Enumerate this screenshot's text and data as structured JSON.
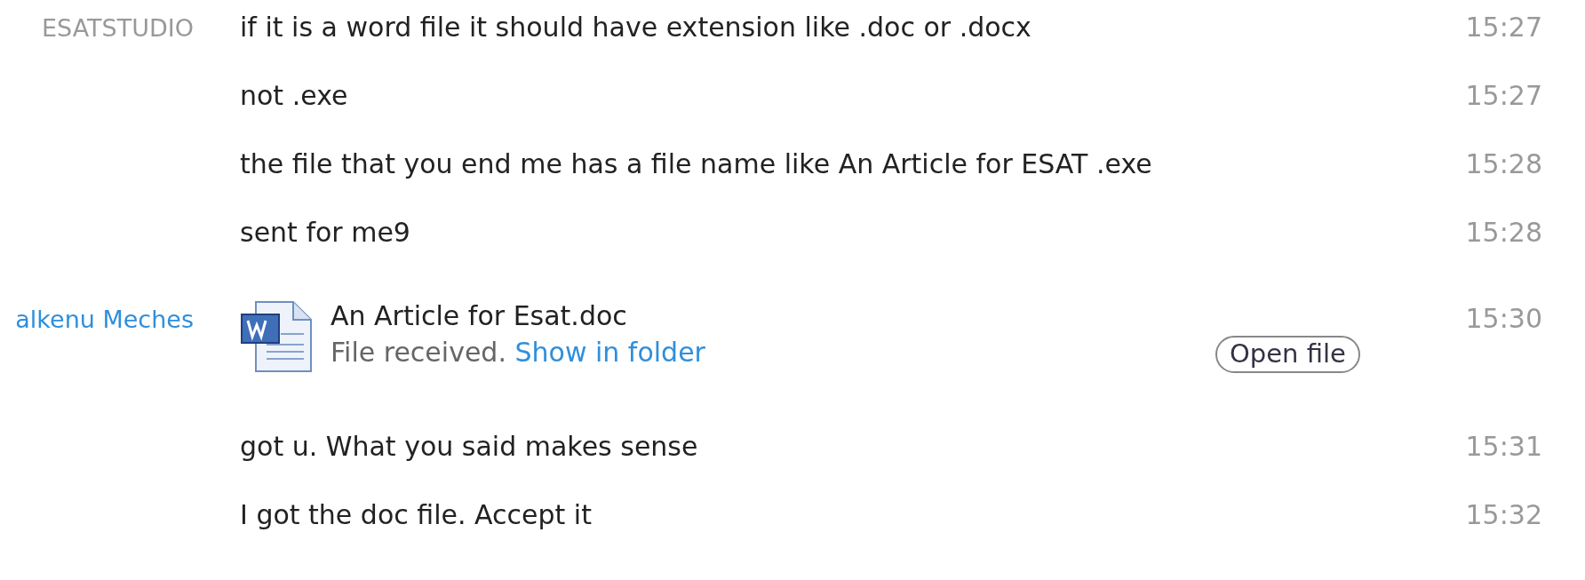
{
  "messages": [
    {
      "kind": "text",
      "sender": "ESATSTUDIO",
      "color": "#999999",
      "text": "if it is a word file it should have extension  like .doc or .docx",
      "time": "15:27"
    },
    {
      "kind": "text",
      "text": "not .exe",
      "time": "15:27"
    },
    {
      "kind": "text",
      "text": "the file that you end me has a file name like  An Article for ESAT .exe",
      "time": "15:28"
    },
    {
      "kind": "text",
      "text": "sent for me9",
      "time": "15:28"
    },
    {
      "kind": "file",
      "sender": "alkenu Meches",
      "color": "#2f8fdc",
      "file_name": "An Article for Esat.doc",
      "status": "File received.",
      "link": "Show in folder",
      "button": "Open file",
      "time": "15:30"
    },
    {
      "kind": "text",
      "text": "got u. What you said makes sense",
      "time": "15:31"
    },
    {
      "kind": "text",
      "text": "I got the doc file. Accept it",
      "time": "15:32"
    }
  ]
}
